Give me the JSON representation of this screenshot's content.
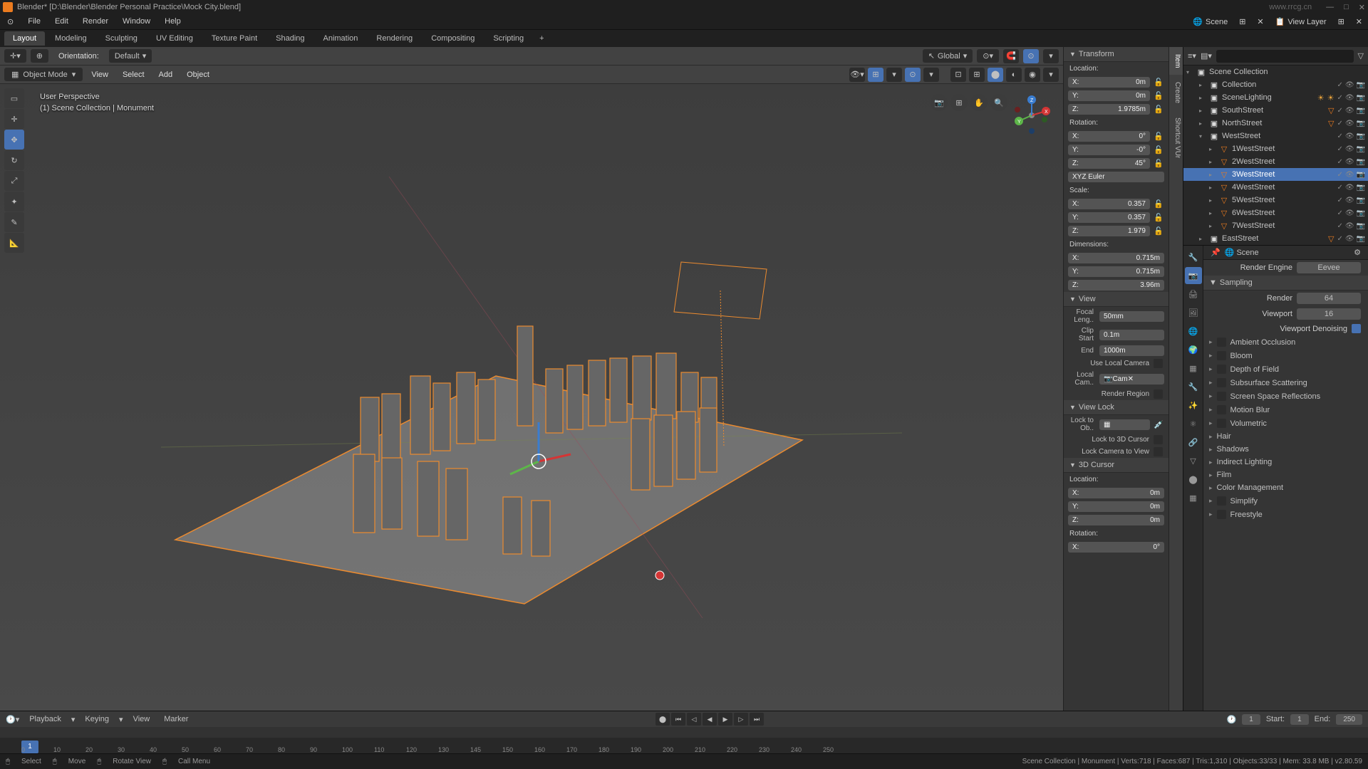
{
  "titlebar": {
    "title": "Blender* [D:\\Blender\\Blender Personal Practice\\Mock City.blend]",
    "watermark": "www.rrcg.cn"
  },
  "menubar": {
    "items": [
      "File",
      "Edit",
      "Render",
      "Window",
      "Help"
    ],
    "scene_label": "Scene",
    "viewlayer_label": "View Layer"
  },
  "workspaces": {
    "tabs": [
      "Layout",
      "Modeling",
      "Sculpting",
      "UV Editing",
      "Texture Paint",
      "Shading",
      "Animation",
      "Rendering",
      "Compositing",
      "Scripting"
    ],
    "active": 0
  },
  "viewport_header": {
    "orientation_label": "Orientation:",
    "orientation_value": "Default",
    "global": "Global"
  },
  "viewport_toolbar2": {
    "mode": "Object Mode",
    "menus": [
      "View",
      "Select",
      "Add",
      "Object"
    ]
  },
  "viewport_overlay": {
    "line1": "User Perspective",
    "line2": "(1) Scene Collection | Monument"
  },
  "n_panel": {
    "transform": {
      "title": "Transform",
      "location_label": "Location:",
      "loc": {
        "x": "0m",
        "y": "0m",
        "z": "1.9785m"
      },
      "rotation_label": "Rotation:",
      "rot": {
        "x": "0°",
        "y": "-0°",
        "z": "45°"
      },
      "rot_mode": "XYZ Euler",
      "scale_label": "Scale:",
      "scale": {
        "x": "0.357",
        "y": "0.357",
        "z": "1.979"
      },
      "dimensions_label": "Dimensions:",
      "dim": {
        "x": "0.715m",
        "y": "0.715m",
        "z": "3.96m"
      }
    },
    "view": {
      "title": "View",
      "focal_label": "Focal Leng..",
      "focal": "50mm",
      "clip_start_label": "Clip Start",
      "clip_start": "0.1m",
      "clip_end_label": "End",
      "clip_end": "1000m",
      "use_local_cam": "Use Local Camera",
      "local_cam_label": "Local Cam..",
      "local_cam_value": "Cam",
      "render_region": "Render Region"
    },
    "viewlock": {
      "title": "View Lock",
      "lock_to_ob": "Lock to Ob..",
      "lock_3d_cursor": "Lock to 3D Cursor",
      "lock_cam_view": "Lock Camera to View"
    },
    "cursor": {
      "title": "3D Cursor",
      "location_label": "Location:",
      "loc": {
        "x": "0m",
        "y": "0m",
        "z": "0m"
      },
      "rotation_label": "Rotation:",
      "rot_x": "0°"
    },
    "tabs": [
      "Item",
      "Create",
      "Shortcut VUr"
    ]
  },
  "outliner": {
    "root": "Scene Collection",
    "items": [
      {
        "name": "Collection",
        "type": "collection",
        "indent": 1,
        "expanded": false
      },
      {
        "name": "SceneLighting",
        "type": "collection",
        "indent": 1,
        "expanded": false,
        "extras": [
          "light",
          "light"
        ]
      },
      {
        "name": "SouthStreet",
        "type": "collection",
        "indent": 1,
        "expanded": false,
        "extras": [
          "mesh"
        ]
      },
      {
        "name": "NorthStreet",
        "type": "collection",
        "indent": 1,
        "expanded": false,
        "extras": [
          "mesh"
        ]
      },
      {
        "name": "WestStreet",
        "type": "collection",
        "indent": 1,
        "expanded": true
      },
      {
        "name": "1WestStreet",
        "type": "mesh",
        "indent": 2
      },
      {
        "name": "2WestStreet",
        "type": "mesh",
        "indent": 2
      },
      {
        "name": "3WestStreet",
        "type": "mesh",
        "indent": 2,
        "selected": true
      },
      {
        "name": "4WestStreet",
        "type": "mesh",
        "indent": 2
      },
      {
        "name": "5WestStreet",
        "type": "mesh",
        "indent": 2
      },
      {
        "name": "6WestStreet",
        "type": "mesh",
        "indent": 2
      },
      {
        "name": "7WestStreet",
        "type": "mesh",
        "indent": 2
      },
      {
        "name": "EastStreet",
        "type": "collection",
        "indent": 1,
        "expanded": false,
        "extras": [
          "mesh"
        ]
      }
    ]
  },
  "properties": {
    "breadcrumb": "Scene",
    "render_engine_label": "Render Engine",
    "render_engine": "Eevee",
    "sampling": {
      "title": "Sampling",
      "render_label": "Render",
      "render": "64",
      "viewport_label": "Viewport",
      "viewport": "16",
      "denoise_label": "Viewport Denoising"
    },
    "sections": [
      "Ambient Occlusion",
      "Bloom",
      "Depth of Field",
      "Subsurface Scattering",
      "Screen Space Reflections",
      "Motion Blur",
      "Volumetric",
      "Hair",
      "Shadows",
      "Indirect Lighting",
      "Film",
      "Color Management",
      "Simplify",
      "Freestyle"
    ]
  },
  "timeline": {
    "menus": [
      "Playback",
      "Keying",
      "View",
      "Marker"
    ],
    "start_label": "Start:",
    "start": "1",
    "end_label": "End:",
    "end": "250",
    "current": "1",
    "ticks": [
      "0",
      "10",
      "20",
      "30",
      "40",
      "50",
      "60",
      "70",
      "80",
      "90",
      "100",
      "110",
      "120",
      "130",
      "145",
      "150",
      "160",
      "170",
      "180",
      "190",
      "200",
      "210",
      "220",
      "230",
      "240",
      "250"
    ],
    "playhead": "1"
  },
  "statusbar": {
    "select": "Select",
    "move": "Move",
    "rotate": "Rotate View",
    "menu": "Call Menu",
    "right": "Scene Collection | Monument | Verts:718 | Faces:687 | Tris:1,310 | Objects:33/33 | Mem: 33.8 MB | v2.80.59"
  }
}
